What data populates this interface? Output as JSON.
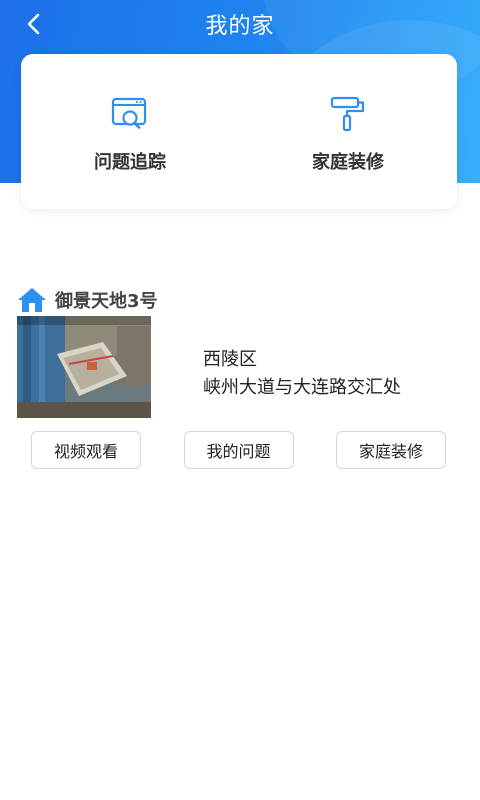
{
  "header": {
    "title": "我的家",
    "back_icon": "chevron-left-icon"
  },
  "menu": {
    "items": [
      {
        "label": "问题追踪",
        "icon": "folder-search-icon"
      },
      {
        "label": "家庭装修",
        "icon": "paint-roller-icon"
      }
    ]
  },
  "estate": {
    "name": "御景天地3号",
    "icon": "home-icon",
    "district": "西陵区",
    "street": "峡州大道与大连路交汇处",
    "actions": [
      "视频观看",
      "我的问题",
      "家庭装修"
    ]
  },
  "colors": {
    "header_start": "#1d6fe8",
    "header_end": "#28a7fb",
    "icon_blue": "#2f8ef4"
  }
}
